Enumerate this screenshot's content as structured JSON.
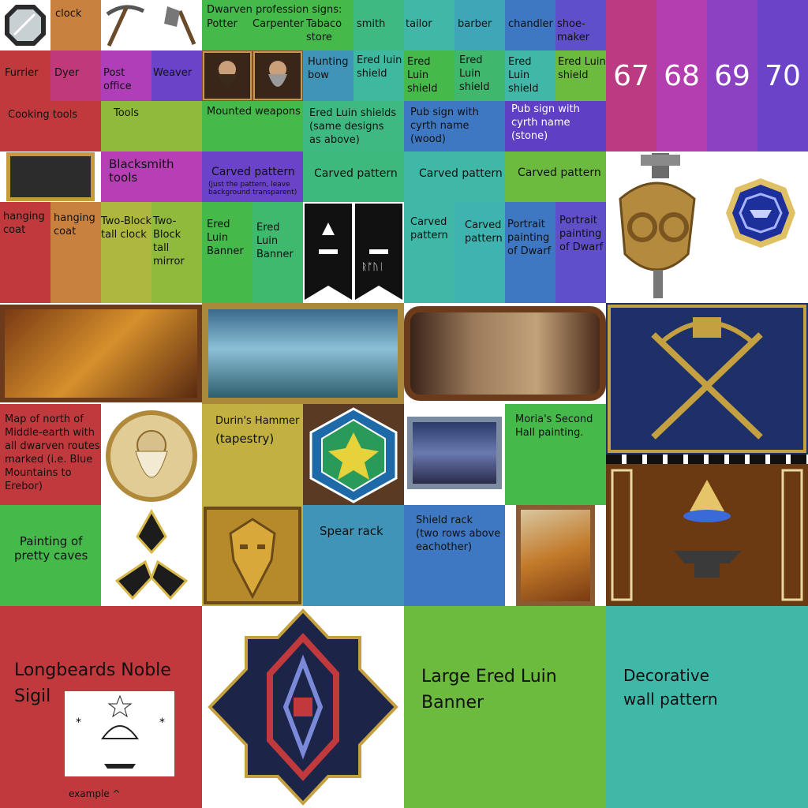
{
  "row1": {
    "clock": "clock",
    "profession_heading": "Dwarven profession signs:",
    "potter": "Potter",
    "carpenter": "Carpenter",
    "tabaco": "Tabaco\nstore",
    "smith": "smith",
    "tailor": "tailor",
    "barber": "barber",
    "chandler": "chandler",
    "shoemaker": "shoe-\nmaker"
  },
  "row2": {
    "furrier": "Furrier",
    "dyer": "Dyer",
    "post": "Post\noffice",
    "weaver": "Weaver",
    "hunting": "Hunting\nbow",
    "shield1": "Ered luin\nshield",
    "shield2": "Ered Luin\nshield",
    "shield3": "Ered Luin\nshield",
    "shield4": "Ered Luin\nshield",
    "shield5": "Ered Luin\nshield"
  },
  "row3": {
    "cooking": "Cooking tools",
    "tools": "Tools",
    "mounted": "Mounted weapons",
    "shields_same": "Ered Luin shields\n(same designs\nas above)",
    "pub_wood": "Pub sign with\ncyrth name (wood)",
    "pub_stone": "Pub sign with\ncyrth name (stone)"
  },
  "numbers": [
    "67",
    "68",
    "69",
    "70"
  ],
  "row4": {
    "blacksmith": "Blacksmith\ntools",
    "carved_main": "Carved pattern",
    "carved_note": "(just the pattern, leave\nbackground transparent)",
    "carved2": "Carved pattern",
    "carved3": "Carved pattern",
    "carved4": "Carved pattern"
  },
  "row5": {
    "coat1": "hanging\ncoat",
    "coat2": "hanging\ncoat",
    "clock_tall": "Two-Block\ntall clock",
    "mirror_tall": "Two-Block\ntall mirror",
    "banner1": "Ered Luin\nBanner",
    "banner2": "Ered\nLuin\nBanner",
    "banner_runes": "ᚱᚩᚢᛁ",
    "carved5": "Carved\npattern",
    "carved6": "Carved\npattern",
    "portrait1": "Portrait\npainting\nof Dwarf",
    "portrait2": "Portrait\npainting\nof Dwarf"
  },
  "row7": {
    "map": "Map of north of\nMiddle-earth with\nall dwarven routes\nmarked (i.e. Blue\nMountains to\nErebor)",
    "durin": "Durin's Hammer",
    "tapestry": "(tapestry)",
    "moria": "Moria's Second\nHall painting."
  },
  "row8": {
    "caves": "Painting of\npretty caves",
    "spear": "Spear rack",
    "shieldrack": "Shield rack\n(two rows above\neachother)"
  },
  "row9": {
    "sigil": "Longbeards Noble\nSigil",
    "example": "example ^",
    "large_banner": "Large Ered Luin\nBanner",
    "decorative": "Decorative\nwall pattern"
  },
  "colors": {
    "red": "#c0393d",
    "orange": "#c9813f",
    "magenta": "#bb3eb5",
    "purple": "#6b43c8",
    "olive": "#8fba3c",
    "green": "#45b94a",
    "teal": "#3fb8a8",
    "blue": "#3f78c2"
  }
}
